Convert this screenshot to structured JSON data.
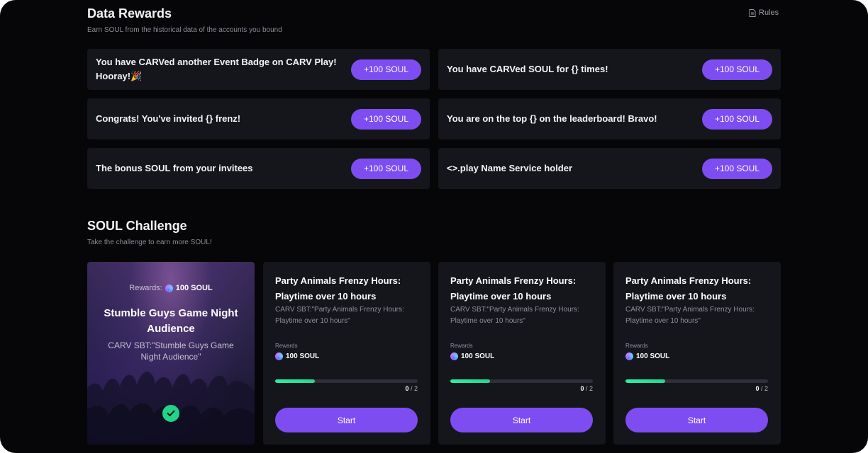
{
  "data_rewards": {
    "title": "Data Rewards",
    "subtitle": "Earn SOUL from the historical data of the accounts you bound",
    "rules_label": "Rules",
    "items": [
      {
        "text": "You have CARVed another Event Badge on CARV Play! Hooray!🎉",
        "button": "+100 SOUL"
      },
      {
        "text": "You have CARVed SOUL for {} times!",
        "button": "+100 SOUL"
      },
      {
        "text": "Congrats! You've invited {} frenz!",
        "button": "+100 SOUL"
      },
      {
        "text": "You are on the top {} on the leaderboard! Bravo!",
        "button": "+100 SOUL"
      },
      {
        "text": "The bonus SOUL from your invitees",
        "button": "+100 SOUL"
      },
      {
        "text": "<>.play Name Service holder",
        "button": "+100 SOUL"
      }
    ]
  },
  "soul_challenge": {
    "title": "SOUL Challenge",
    "subtitle": "Take the challenge to earn more SOUL!",
    "featured": {
      "rewards_label": "Rewards:",
      "rewards_value": "100 SOUL",
      "title": "Stumble Guys Game Night Audience",
      "description": "CARV SBT:\"Stumble Guys Game Night Audience\"",
      "completed": true
    },
    "cards": [
      {
        "title": "Party Animals Frenzy Hours: Playtime over 10 hours",
        "description": "CARV SBT:\"Party Animals Frenzy Hours: Playtime over 10 hours\"",
        "rewards_label": "Rewards",
        "rewards_value": "100 SOUL",
        "progress_current": "0",
        "progress_total": "/ 2",
        "progress_fraction": 0.28,
        "button": "Start"
      },
      {
        "title": "Party Animals Frenzy Hours: Playtime over 10 hours",
        "description": "CARV SBT:\"Party Animals Frenzy Hours: Playtime over 10 hours\"",
        "rewards_label": "Rewards",
        "rewards_value": "100 SOUL",
        "progress_current": "0",
        "progress_total": "/ 2",
        "progress_fraction": 0.28,
        "button": "Start"
      },
      {
        "title": "Party Animals Frenzy Hours: Playtime over 10 hours",
        "description": "CARV SBT:\"Party Animals Frenzy Hours: Playtime over 10 hours\"",
        "rewards_label": "Rewards",
        "rewards_value": "100 SOUL",
        "progress_current": "0",
        "progress_total": "/ 2",
        "progress_fraction": 0.28,
        "button": "Start"
      }
    ]
  },
  "icons": {
    "rules": "document-icon",
    "soul": "soul-token-icon",
    "completed": "check-circle-icon"
  },
  "colors": {
    "accent": "#7d4df2",
    "progress": "#2af0a0",
    "success": "#23d38a",
    "card_bg": "#15161c",
    "page_bg": "#060608"
  }
}
